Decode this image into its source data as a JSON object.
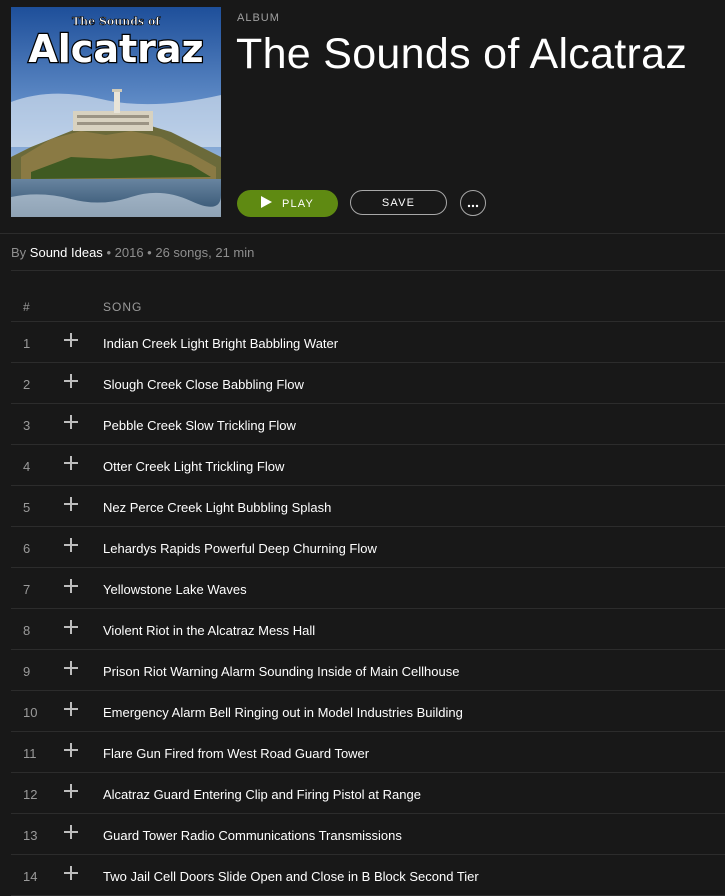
{
  "album": {
    "label": "ALBUM",
    "title": "The Sounds of Alcatraz",
    "cover_small_text": "The Sounds of",
    "cover_big_text": "Alcatraz"
  },
  "actions": {
    "play_label": "PLAY",
    "save_label": "SAVE",
    "more_icon": "ellipsis-icon"
  },
  "meta": {
    "by_prefix": "By",
    "artist": "Sound Ideas",
    "separator": "•",
    "year": "2016",
    "stats": "26 songs, 21 min"
  },
  "tracklist": {
    "header_num": "#",
    "header_song": "SONG",
    "tracks": [
      {
        "num": "1",
        "title": "Indian Creek Light Bright Babbling Water"
      },
      {
        "num": "2",
        "title": "Slough Creek Close Babbling Flow"
      },
      {
        "num": "3",
        "title": "Pebble Creek Slow Trickling Flow"
      },
      {
        "num": "4",
        "title": "Otter Creek Light Trickling Flow"
      },
      {
        "num": "5",
        "title": "Nez Perce Creek Light Bubbling Splash"
      },
      {
        "num": "6",
        "title": "Lehardys Rapids Powerful Deep Churning Flow"
      },
      {
        "num": "7",
        "title": "Yellowstone Lake Waves"
      },
      {
        "num": "8",
        "title": "Violent Riot in the Alcatraz Mess Hall"
      },
      {
        "num": "9",
        "title": "Prison Riot Warning Alarm Sounding Inside of Main Cellhouse"
      },
      {
        "num": "10",
        "title": "Emergency Alarm Bell Ringing out in Model Industries Building"
      },
      {
        "num": "11",
        "title": "Flare Gun Fired from West Road Guard Tower"
      },
      {
        "num": "12",
        "title": "Alcatraz Guard Entering Clip and Firing Pistol at Range"
      },
      {
        "num": "13",
        "title": "Guard Tower Radio Communications Transmissions"
      },
      {
        "num": "14",
        "title": "Two Jail Cell Doors Slide Open and Close in B Block Second Tier"
      }
    ]
  },
  "colors": {
    "background": "#181818",
    "play_button": "#5f8a12",
    "divider": "#2c2c2c",
    "muted_text": "#9a9a9a"
  }
}
